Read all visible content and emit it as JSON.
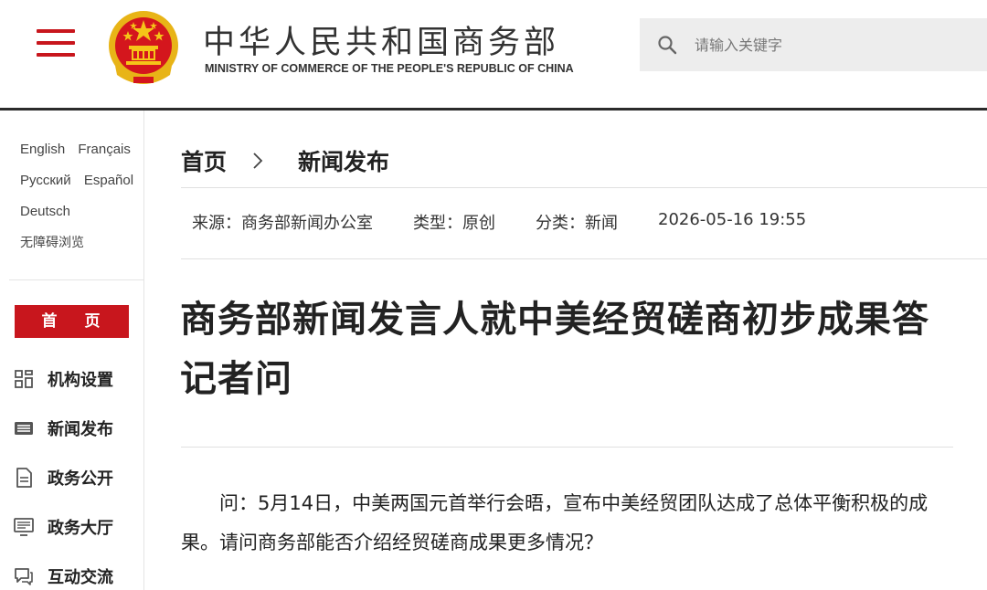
{
  "header": {
    "title": "中华人民共和国商务部",
    "subtitle": "MINISTRY OF COMMERCE OF THE PEOPLE'S REPUBLIC OF CHINA",
    "search_placeholder": "请输入关键字",
    "menu_icon": "hamburger-menu-icon",
    "emblem_icon": "national-emblem-icon",
    "accent_color": "#c8161d"
  },
  "sidebar": {
    "languages": [
      [
        "English",
        "Français"
      ],
      [
        "Русский",
        "Español"
      ],
      [
        "Deutsch"
      ]
    ],
    "accessibility": "无障碍浏览",
    "home_label": "首 页",
    "nav": [
      {
        "label": "机构设置",
        "icon": "org-grid-icon"
      },
      {
        "label": "新闻发布",
        "icon": "news-list-icon"
      },
      {
        "label": "政务公开",
        "icon": "document-icon"
      },
      {
        "label": "政务大厅",
        "icon": "monitor-icon"
      },
      {
        "label": "互动交流",
        "icon": "chat-icon"
      }
    ]
  },
  "breadcrumb": {
    "home": "首页",
    "current": "新闻发布"
  },
  "meta": {
    "source": "来源：商务部新闻办公室",
    "type": "类型：原创",
    "category": "分类：新闻",
    "datetime": "2026-05-16 19:55"
  },
  "article": {
    "title": "商务部新闻发言人就中美经贸磋商初步成果答记者问",
    "body": "问：5月14日，中美两国元首举行会晤，宣布中美经贸团队达成了总体平衡积极的成果。请问商务部能否介绍经贸磋商成果更多情况？"
  }
}
